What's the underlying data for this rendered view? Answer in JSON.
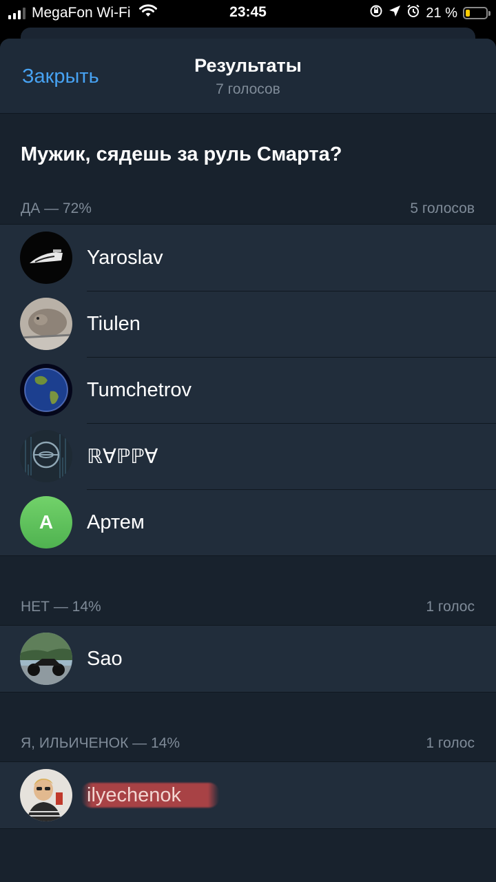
{
  "status_bar": {
    "carrier": "MegaFon Wi-Fi",
    "time": "23:45",
    "battery": "21 %",
    "battery_level": 0.21
  },
  "header": {
    "close_label": "Закрыть",
    "title": "Результаты",
    "subtitle": "7 голосов"
  },
  "poll": {
    "question": "Мужик, сядешь за руль Смарта?",
    "options": [
      {
        "label": "ДА — 72%",
        "count": "5 голосов",
        "voters": [
          {
            "name": "Yaroslav",
            "avatar": "iron-avatar"
          },
          {
            "name": "Tiulen",
            "avatar": "seal-avatar"
          },
          {
            "name": "Tumchetrov",
            "avatar": "earth-avatar"
          },
          {
            "name": "ℝ∀ℙℙ∀",
            "avatar": "logo-avatar"
          },
          {
            "name": "Артем",
            "avatar": "initial-avatar",
            "initial": "А",
            "color": "#5fc45e"
          }
        ]
      },
      {
        "label": "НЕТ — 14%",
        "count": "1 голос",
        "voters": [
          {
            "name": "Sao",
            "avatar": "motorcycle-avatar"
          }
        ]
      },
      {
        "label": "Я, ИЛЬИЧЕНОК — 14%",
        "count": "1 голос",
        "voters": [
          {
            "name": "ilyechenok",
            "avatar": "selfie-avatar"
          }
        ]
      }
    ]
  },
  "colors": {
    "accent": "#47a2f2",
    "background": "#18222d",
    "cell": "#212d3b",
    "secondary_text": "#7f8b98"
  }
}
